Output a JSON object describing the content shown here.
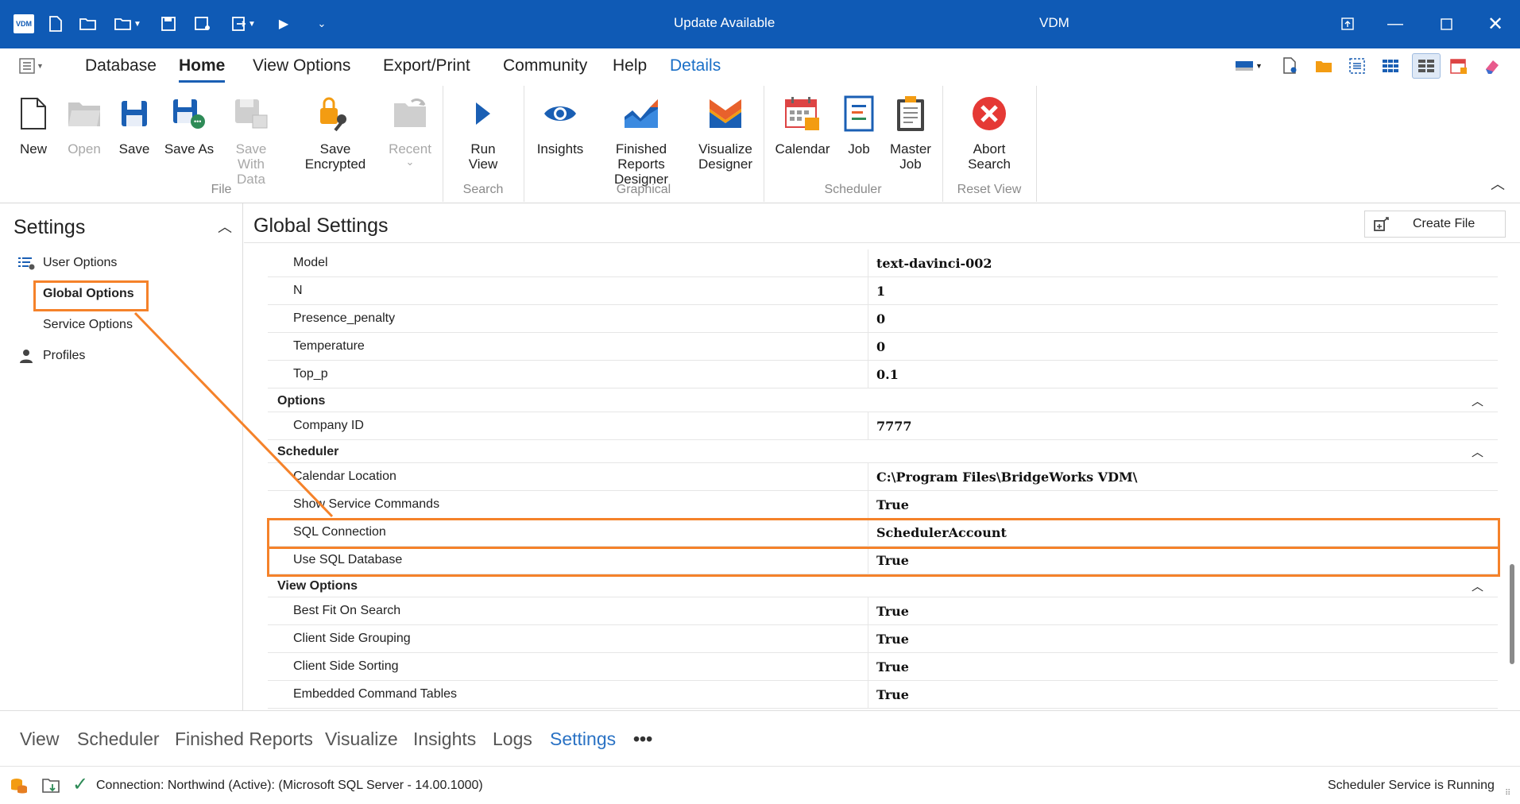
{
  "titlebar": {
    "logo": "VDM",
    "update_text": "Update Available",
    "app_name": "VDM",
    "bg_color": "#0f5ab5",
    "icons": [
      "new-file-icon",
      "open-folder-icon",
      "open-recent-icon",
      "save-icon",
      "save-as-icon",
      "export-icon",
      "run-icon",
      "customize-icon"
    ],
    "window_controls": [
      "restore-app-icon",
      "minimize-icon",
      "maximize-icon",
      "close-icon"
    ]
  },
  "menu": {
    "items": [
      {
        "label": "Database"
      },
      {
        "label": "Home"
      },
      {
        "label": "View Options"
      },
      {
        "label": "Export/Print"
      },
      {
        "label": "Community"
      },
      {
        "label": "Help"
      },
      {
        "label": "Details"
      }
    ],
    "active": "Home",
    "accent_color": "#1a6fc7"
  },
  "ribbon": {
    "groups": [
      {
        "label": "File"
      },
      {
        "label": "Search"
      },
      {
        "label": "Graphical"
      },
      {
        "label": "Scheduler"
      },
      {
        "label": "Reset View"
      }
    ],
    "buttons": {
      "new": {
        "line1": "New"
      },
      "open": {
        "line1": "Open"
      },
      "save": {
        "line1": "Save"
      },
      "save_as": {
        "line1": "Save As"
      },
      "save_with_data": {
        "line1": "Save With",
        "line2": "Data"
      },
      "save_encrypted": {
        "line1": "Save Encrypted"
      },
      "recent": {
        "line1": "Recent",
        "line2": "⌄"
      },
      "run_view": {
        "line1": "Run View"
      },
      "insights": {
        "line1": "Insights"
      },
      "finished_reports": {
        "line1": "Finished Reports",
        "line2": "Designer"
      },
      "visualize": {
        "line1": "Visualize",
        "line2": "Designer"
      },
      "calendar": {
        "line1": "Calendar"
      },
      "job": {
        "line1": "Job"
      },
      "master_job": {
        "line1": "Master",
        "line2": "Job"
      },
      "abort": {
        "line1": "Abort",
        "line2": "Search"
      }
    }
  },
  "nav": {
    "title": "Settings",
    "items": [
      {
        "label": "User Options"
      },
      {
        "label": "Global Options"
      },
      {
        "label": "Service Options"
      },
      {
        "label": "Profiles"
      }
    ]
  },
  "main": {
    "title": "Global Settings",
    "create_file": "Create File",
    "rows": {
      "model": {
        "key": "Model",
        "value": "text-davinci-002"
      },
      "n": {
        "key": "N",
        "value": "1"
      },
      "presence": {
        "key": "Presence_penalty",
        "value": "0"
      },
      "temperature": {
        "key": "Temperature",
        "value": "0"
      },
      "top_p": {
        "key": "Top_p",
        "value": "0.1"
      },
      "company_id": {
        "key": "Company ID",
        "value": "7777"
      },
      "calendar_location": {
        "key": "Calendar Location",
        "value": "C:\\Program Files\\BridgeWorks VDM\\"
      },
      "show_service": {
        "key": "Show Service Commands",
        "value": "True"
      },
      "sql_connection": {
        "key": "SQL Connection",
        "value": "SchedulerAccount"
      },
      "use_sql": {
        "key": "Use SQL Database",
        "value": "True"
      },
      "best_fit": {
        "key": "Best Fit On Search",
        "value": "True"
      },
      "client_grouping": {
        "key": "Client Side Grouping",
        "value": "True"
      },
      "client_sorting": {
        "key": "Client Side Sorting",
        "value": "True"
      },
      "embedded": {
        "key": "Embedded Command Tables",
        "value": "True"
      }
    },
    "categories": {
      "options": "Options",
      "scheduler": "Scheduler",
      "view_options": "View Options"
    }
  },
  "tabs": {
    "items": [
      {
        "label": "View"
      },
      {
        "label": "Scheduler"
      },
      {
        "label": "Finished Reports"
      },
      {
        "label": "Visualize"
      },
      {
        "label": "Insights"
      },
      {
        "label": "Logs"
      },
      {
        "label": "Settings"
      },
      {
        "label": "•••"
      }
    ],
    "active": "Settings"
  },
  "status": {
    "connection": "Connection: Northwind (Active): (Microsoft SQL Server - 14.00.1000)",
    "service": "Scheduler Service is Running"
  },
  "highlight_color": "#f5822a"
}
